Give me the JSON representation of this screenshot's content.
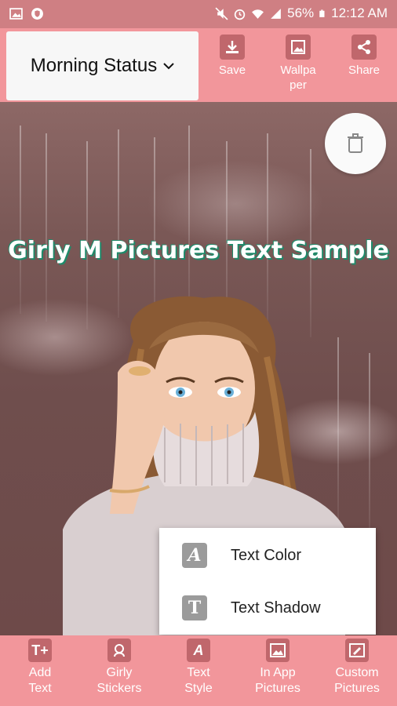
{
  "status_bar": {
    "battery": "56%",
    "time": "12:12 AM"
  },
  "toolbar": {
    "category": "Morning Status",
    "save_label": "Save",
    "wallpaper_label": "Wallpa\nper",
    "share_label": "Share"
  },
  "canvas": {
    "sample_text": "Girly M Pictures Text Sample"
  },
  "popup_menu": {
    "items": [
      {
        "label": "Text Color",
        "icon": "text-color-icon"
      },
      {
        "label": "Text Shadow",
        "icon": "text-shadow-icon"
      }
    ]
  },
  "bottom_bar": {
    "items": [
      {
        "label": "Add\nText",
        "icon": "add-text-icon"
      },
      {
        "label": "Girly\nStickers",
        "icon": "girl-sticker-icon"
      },
      {
        "label": "Text\nStyle",
        "icon": "text-style-icon"
      },
      {
        "label": "In App\nPictures",
        "icon": "gallery-icon"
      },
      {
        "label": "Custom\nPictures",
        "icon": "custom-picture-icon"
      }
    ]
  },
  "colors": {
    "primary": "#f2969b",
    "status": "#cf7f83",
    "icon_bg": "#c0676c",
    "text_shadow": "#1f8a6a"
  }
}
